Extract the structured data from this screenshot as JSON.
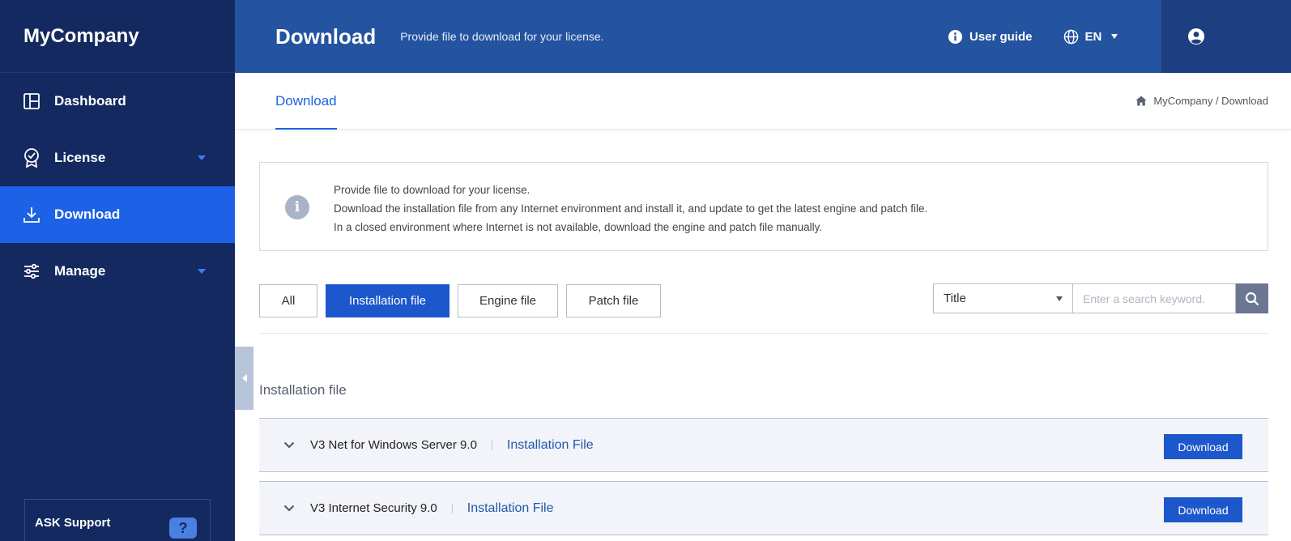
{
  "app": {
    "name": "MyCompany"
  },
  "sidebar": {
    "items": [
      {
        "label": "Dashboard",
        "icon": "dashboard-icon"
      },
      {
        "label": "License",
        "icon": "license-badge-icon"
      },
      {
        "label": "Download",
        "icon": "download-icon",
        "active": true
      },
      {
        "label": "Manage",
        "icon": "sliders-icon"
      }
    ],
    "support_label": "ASK Support",
    "support_icon_glyph": "?"
  },
  "header": {
    "title": "Download",
    "subtitle": "Provide file to download for your license.",
    "user_guide": "User guide",
    "language": "EN"
  },
  "subbar": {
    "tab": "Download",
    "breadcrumb": "MyCompany / Download"
  },
  "info": {
    "glyph": "i",
    "lines": [
      "Provide file to download for your license.",
      "Download the installation file from any Internet environment and install it, and update to get the latest engine and patch file.",
      "In a closed environment where Internet is not available, download the engine and patch file manually."
    ]
  },
  "filters": [
    "All",
    "Installation file",
    "Engine file",
    "Patch file"
  ],
  "search": {
    "field": "Title",
    "placeholder": "Enter a search keyword."
  },
  "section_title": "Installation file",
  "files": [
    {
      "name": "V3 Net for Windows Server 9.0",
      "type": "Installation File",
      "action": "Download"
    },
    {
      "name": "V3 Internet Security 9.0",
      "type": "Installation File",
      "action": "Download"
    }
  ],
  "colors": {
    "sidebar": "#13295f",
    "header": "#2453a0",
    "accent": "#1d62e6",
    "primary_button": "#1d57cc"
  }
}
